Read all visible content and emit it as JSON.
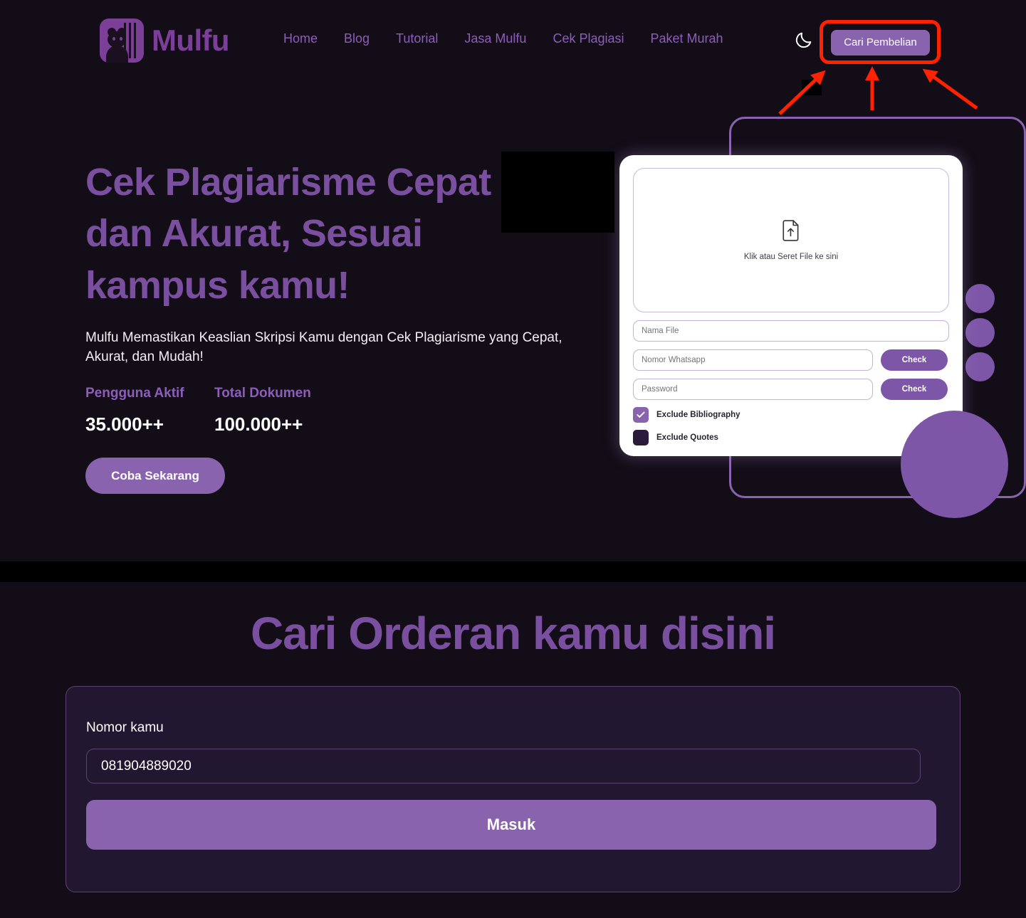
{
  "header": {
    "brand_name": "Mulfu",
    "logo_icon": "bear-book-logo-icon",
    "nav": [
      {
        "label": "Home"
      },
      {
        "label": "Blog"
      },
      {
        "label": "Tutorial"
      },
      {
        "label": "Jasa Mulfu"
      },
      {
        "label": "Cek Plagiasi"
      },
      {
        "label": "Paket Murah"
      }
    ],
    "theme_toggle_icon": "moon-icon",
    "cta_label": "Cari Pembelian"
  },
  "annotation": {
    "highlight_color": "#FF2200",
    "arrow_count": 3,
    "target": "Cari Pembelian"
  },
  "hero": {
    "title_lines": [
      "Cek Plagiarisme Cepat",
      "dan Akurat, Sesuai",
      "kampus kamu!"
    ],
    "subtitle": "Mulfu Memastikan Keaslian Skripsi Kamu dengan Cek Plagiarisme yang Cepat, Akurat, dan Mudah!",
    "stats": [
      {
        "label": "Pengguna Aktif",
        "value": "35.000++"
      },
      {
        "label": "Total Dokumen",
        "value": "100.000++"
      }
    ],
    "cta_label": "Coba Sekarang"
  },
  "app_card": {
    "dropzone": {
      "icon": "file-upload-icon",
      "label": "Klik atau Seret File ke sini"
    },
    "fields": [
      {
        "placeholder": "Nama File",
        "value": ""
      },
      {
        "placeholder": "Nomor Whatsapp",
        "value": ""
      },
      {
        "placeholder": "Password",
        "value": ""
      }
    ],
    "check_label_whatsapp": "Check",
    "check_label_password": "Check",
    "checkboxes": [
      {
        "label": "Exclude Bibliography",
        "checked": true
      },
      {
        "label": "Exclude Quotes",
        "checked": false
      }
    ]
  },
  "lower": {
    "section_title": "Cari Orderan kamu disini",
    "form": {
      "nomor_label": "Nomor kamu",
      "nomor_value": "081904889020",
      "nomor_placeholder": "Nomor kamu",
      "submit_label": "Masuk"
    }
  },
  "colors": {
    "background": "#130D18",
    "accent_purple": "#8A63AE",
    "heading_purple": "#7B4FA0",
    "nav_purple": "#8E5DBB",
    "annotation_red": "#FF2200",
    "card_background": "#221731",
    "divider_black": "#000000"
  }
}
